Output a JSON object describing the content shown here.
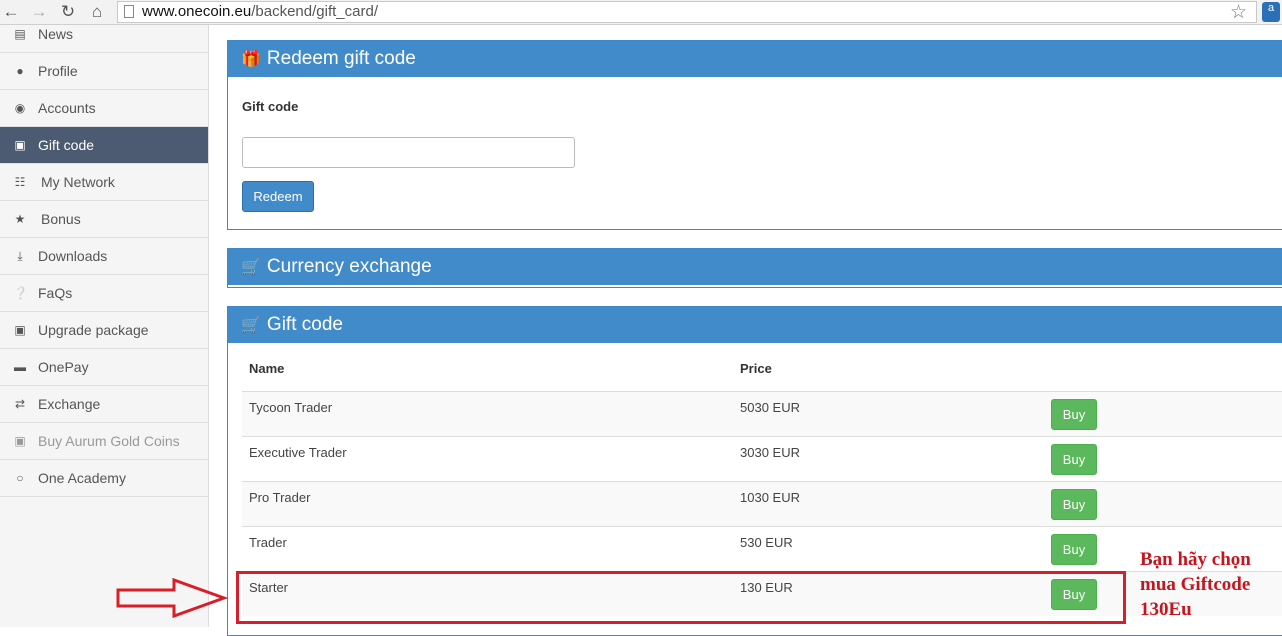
{
  "browser": {
    "url_host": "www.onecoin.eu",
    "url_path": "/backend/gift_card/",
    "back_icon": "back-arrow-icon",
    "forward_icon": "forward-arrow-icon",
    "reload_icon": "reload-icon",
    "home_icon": "home-icon",
    "ext_label": "a"
  },
  "sidebar": {
    "items": [
      {
        "label": "News",
        "icon": "newspaper-icon"
      },
      {
        "label": "Profile",
        "icon": "user-icon"
      },
      {
        "label": "Accounts",
        "icon": "dashboard-icon"
      },
      {
        "label": "Gift code",
        "icon": "cart-icon"
      },
      {
        "label": "My Network",
        "icon": "network-icon"
      },
      {
        "label": "Bonus",
        "icon": "star-icon"
      },
      {
        "label": "Downloads",
        "icon": "download-icon"
      },
      {
        "label": "FaQs",
        "icon": "question-icon"
      },
      {
        "label": "Upgrade package",
        "icon": "cart-icon"
      },
      {
        "label": "OnePay",
        "icon": "card-icon"
      },
      {
        "label": "Exchange",
        "icon": "exchange-icon"
      },
      {
        "label": "Buy Aurum Gold Coins",
        "icon": "cart-icon"
      },
      {
        "label": "One Academy",
        "icon": "circle-icon"
      }
    ]
  },
  "redeem_panel": {
    "title": "Redeem gift code",
    "field_label": "Gift code",
    "input_value": "",
    "button_label": "Redeem"
  },
  "exchange_panel": {
    "title": "Currency exchange"
  },
  "giftcode_panel": {
    "title": "Gift code",
    "columns": [
      "Name",
      "Price"
    ],
    "rows": [
      {
        "name": "Tycoon Trader",
        "price": "5030 EUR",
        "action": "Buy"
      },
      {
        "name": "Executive Trader",
        "price": "3030 EUR",
        "action": "Buy"
      },
      {
        "name": "Pro Trader",
        "price": "1030 EUR",
        "action": "Buy"
      },
      {
        "name": "Trader",
        "price": "530 EUR",
        "action": "Buy"
      },
      {
        "name": "Starter",
        "price": "130 EUR",
        "action": "Buy"
      }
    ]
  },
  "annotation": {
    "note_lines": [
      "Bạn hãy chọn",
      "mua Giftcode",
      "130Eu"
    ],
    "color": "#d81e28"
  },
  "colors": {
    "primary": "#428bca",
    "success": "#5cb85c",
    "sidebar_active": "#4c5a72"
  }
}
